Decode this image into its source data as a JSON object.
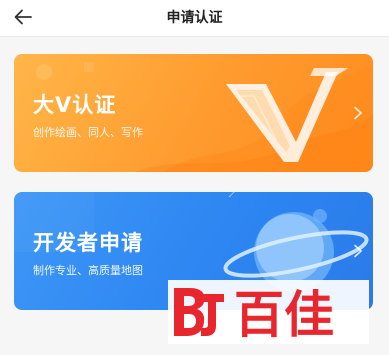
{
  "header": {
    "title": "申请认证"
  },
  "cards": [
    {
      "title": "大V认证",
      "subtitle": "创作绘画、同人、写作",
      "color": "#ff9a2e",
      "illustration": "v-letter-icon"
    },
    {
      "title": "开发者申请",
      "subtitle": "制作专业、高质量地图",
      "color": "#2d86f2",
      "illustration": "planet-icon"
    }
  ],
  "watermark": {
    "text": "百佳",
    "color": "#e8262e"
  }
}
